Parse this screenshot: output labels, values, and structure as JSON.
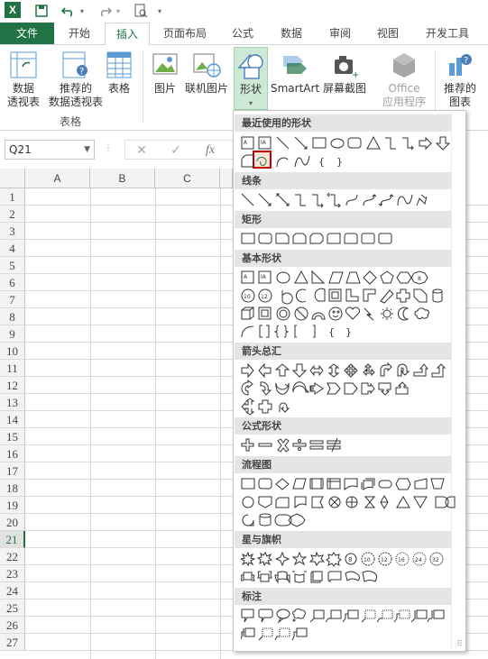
{
  "tabs": [
    {
      "label": "文件",
      "state": "file"
    },
    {
      "label": "开始",
      "state": "normal"
    },
    {
      "label": "插入",
      "state": "active"
    },
    {
      "label": "页面布局",
      "state": "normal"
    },
    {
      "label": "公式",
      "state": "normal"
    },
    {
      "label": "数据",
      "state": "normal"
    },
    {
      "label": "审阅",
      "state": "normal"
    },
    {
      "label": "视图",
      "state": "normal"
    },
    {
      "label": "开发工具",
      "state": "normal"
    }
  ],
  "ribbon": {
    "pivot_line1": "数据",
    "pivot_line2": "透视表",
    "rec_pivot_line1": "推荐的",
    "rec_pivot_line2": "数据透视表",
    "table": "表格",
    "group_tables": "表格",
    "picture": "图片",
    "online_picture": "联机图片",
    "shapes": "形状",
    "smartart": "SmartArt",
    "screenshot": "屏幕截图",
    "office_line1": "Office",
    "office_line2": "应用程序",
    "rec_chart_line1": "推荐的",
    "rec_chart_line2": "图表"
  },
  "formula_bar": {
    "name_box": "Q21",
    "fx": "fx"
  },
  "columns": [
    "A",
    "B",
    "C"
  ],
  "rows": [
    "1",
    "2",
    "3",
    "4",
    "5",
    "6",
    "7",
    "8",
    "9",
    "10",
    "11",
    "12",
    "13",
    "14",
    "15",
    "16",
    "17",
    "18",
    "19",
    "20",
    "21",
    "22",
    "23",
    "24",
    "25",
    "26",
    "27"
  ],
  "selected_row": "21",
  "shapes_panel": {
    "sections": {
      "recent": "最近使用的形状",
      "lines": "线条",
      "rect": "矩形",
      "basic": "基本形状",
      "arrows": "箭头总汇",
      "equation": "公式形状",
      "flowchart": "流程图",
      "stars": "星与旗帜",
      "callouts": "标注"
    },
    "bracket_open": "{",
    "bracket_close": "}"
  },
  "colors": {
    "brand": "#217346",
    "highlight": "#c00000"
  }
}
